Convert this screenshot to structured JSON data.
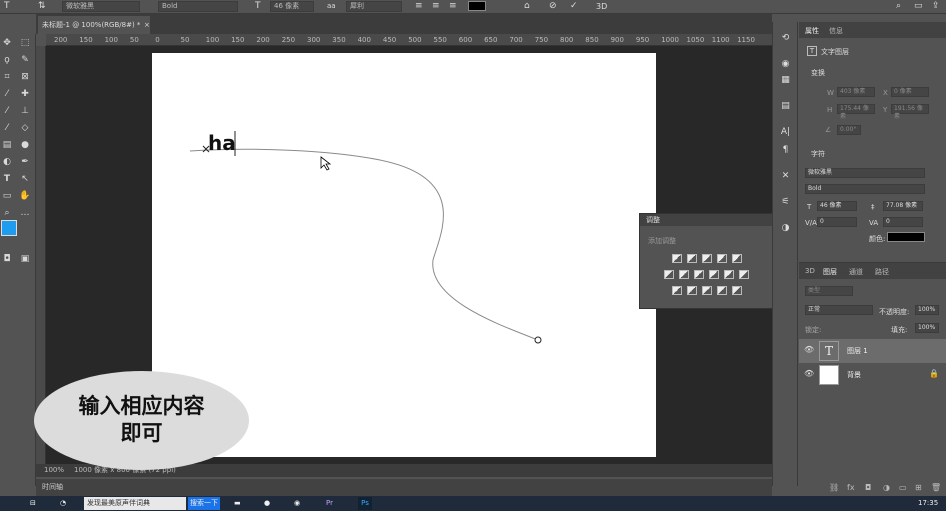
{
  "optbar": {
    "font_family": "微软雅黑",
    "font_style": "Bold",
    "font_size": "46 像素",
    "antialias": "犀利",
    "btn_3d": "3D"
  },
  "document": {
    "tab_title": "未标题-1 @ 100%(RGB/8#) *",
    "close": "×",
    "typed_text": "ha",
    "status_zoom": "100%",
    "status_info": "1000 像素 x 800 像素 (72 ppi)",
    "timeline_label": "时间轴"
  },
  "ruler": {
    "h_ticks": [
      "200",
      "150",
      "100",
      "50",
      "0",
      "50",
      "100",
      "150",
      "200",
      "250",
      "300",
      "350",
      "400",
      "450",
      "500",
      "550",
      "600",
      "650",
      "700",
      "750",
      "800",
      "850",
      "900",
      "950",
      "1000",
      "1050",
      "1100",
      "1150"
    ]
  },
  "callout": {
    "line1": "输入相应内容",
    "line2": "即可"
  },
  "adjustments": {
    "title": "调整",
    "subtitle": "添加调整"
  },
  "properties": {
    "tab1": "属性",
    "tab2": "信息",
    "layer_type": "文字图层",
    "section_transform": "变换",
    "w_label": "W",
    "w_value": "403 像素",
    "x_label": "X",
    "x_value": "0 像素",
    "h_label": "H",
    "h_value": "175.44 像素",
    "y_label": "Y",
    "y_value": "191.56 像素",
    "angle_value": "0.00°",
    "section_char": "字符",
    "font_family": "微软雅黑",
    "font_style": "Bold",
    "font_size": "46 像素",
    "leading": "77.08 像素",
    "kerning": "0",
    "tracking": "0",
    "color_label": "颜色:",
    "text_color": "#000000"
  },
  "layers": {
    "tabs": [
      "3D",
      "图层",
      "通道",
      "路径"
    ],
    "active_tab": "图层",
    "kind_placeholder": "类型",
    "blend_mode": "正常",
    "opacity_label": "不透明度:",
    "opacity_value": "100%",
    "lock_label": "锁定:",
    "fill_label": "填充:",
    "fill_value": "100%",
    "items": [
      {
        "name": "图层 1",
        "type": "text",
        "selected": true
      },
      {
        "name": "背景",
        "type": "background",
        "selected": false
      }
    ]
  },
  "taskbar": {
    "window_title": "发现最美原声伴词典",
    "button": "搜索一下",
    "time": "17:35"
  },
  "colors": {
    "foreground": "#1e9cf0",
    "background": "#ffffff",
    "ui_dark": "#535353",
    "workspace": "#282828"
  }
}
